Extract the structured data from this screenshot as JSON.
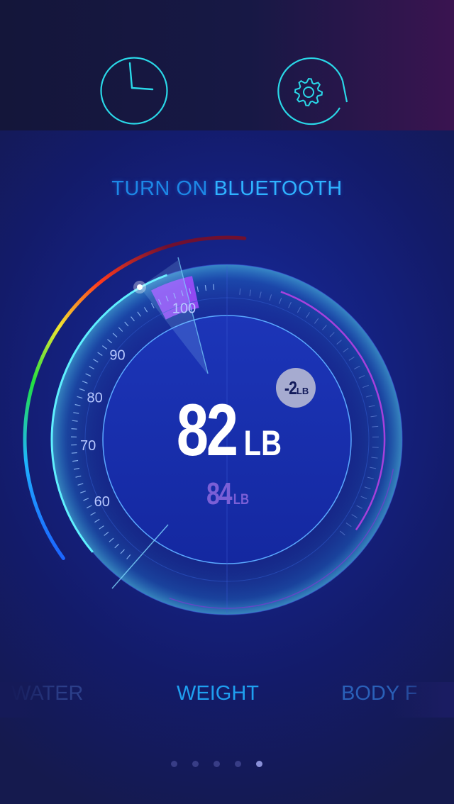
{
  "header": {
    "history_icon": "clock-icon",
    "settings_icon": "gear-icon"
  },
  "status": {
    "prefix": "TURN ON ",
    "highlight": "BLUETOOTH"
  },
  "gauge": {
    "tick_labels": [
      "60",
      "70",
      "80",
      "90",
      "100"
    ],
    "current_value": "82",
    "current_unit": "LB",
    "previous_value": "84",
    "previous_unit": "LB",
    "delta_value": "-2",
    "delta_unit": "LB"
  },
  "tabs": [
    {
      "label": "WATER",
      "active": false
    },
    {
      "label": "WEIGHT",
      "active": true
    },
    {
      "label": "BODY F",
      "active": false
    }
  ],
  "pager": {
    "count": 5,
    "active_index": 4
  },
  "colors": {
    "accent": "#2fb2ff",
    "cyan": "#48e6ff",
    "purple": "#a64cff"
  }
}
